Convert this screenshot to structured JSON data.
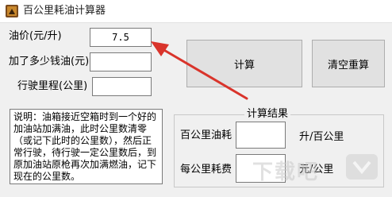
{
  "window": {
    "title": "百公里耗油计算器"
  },
  "form": {
    "price_label": "油价(元/升)",
    "price_value": "7.5",
    "fuel_label": "加了多少钱油(元)",
    "fuel_value": "",
    "distance_label": "行驶里程(公里)",
    "distance_value": ""
  },
  "buttons": {
    "calculate": "计算",
    "reset": "清空重算"
  },
  "notes": {
    "text": "说明：油箱接近空箱时到一个好的加油站加满油，此时公里数清零（或记下此时的公里数），然后正常行驶，待行驶一定公里数后，到原加油站原枪再次加满燃油，记下现在的公里数。"
  },
  "results": {
    "group_title": "计算结果",
    "per100_label": "百公里油耗",
    "per100_value": "",
    "per100_unit": "升/百公里",
    "cost_label": "每公里耗费",
    "cost_value": "",
    "cost_unit": "元/公里"
  },
  "watermark": {
    "text": "下载吧"
  },
  "colors": {
    "arrow": "#d9342b",
    "button_face": "#e1e1e1",
    "window_bg": "#f0f0f0"
  },
  "icons": {
    "app": "fuel-gauge-icon"
  }
}
